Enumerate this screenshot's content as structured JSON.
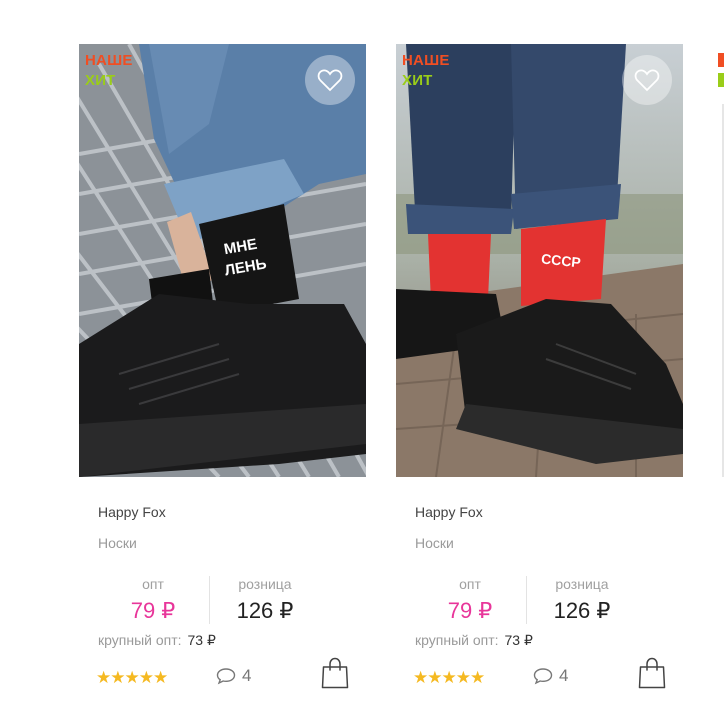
{
  "products": [
    {
      "badge_line1": "НАШЕ",
      "badge_line2": "ХИТ",
      "sock_print_lines": [
        "МНЕ",
        "ЛЕНЬ"
      ],
      "brand": "Happy Fox",
      "category": "Носки",
      "opt_label": "опт",
      "opt_price": "79 ₽",
      "retail_label": "розница",
      "retail_price": "126 ₽",
      "bulk_label": "крупный опт:",
      "bulk_price": "73 ₽",
      "rating": 5,
      "rating_stars": "★★★★★",
      "comments_count": "4",
      "icons": [
        "heart-icon",
        "comment-icon",
        "shopping-bag-icon"
      ]
    },
    {
      "badge_line1": "НАШЕ",
      "badge_line2": "ХИТ",
      "sock_print_lines": [
        "СССР"
      ],
      "brand": "Happy Fox",
      "category": "Носки",
      "opt_label": "опт",
      "opt_price": "79 ₽",
      "retail_label": "розница",
      "retail_price": "126 ₽",
      "bulk_label": "крупный опт:",
      "bulk_price": "73 ₽",
      "rating": 5,
      "rating_stars": "★★★★★",
      "comments_count": "4",
      "icons": [
        "heart-icon",
        "comment-icon",
        "shopping-bag-icon"
      ]
    }
  ],
  "colors": {
    "badge_line1": "#f04e23",
    "badge_line2": "#9acd19",
    "opt_price": "#e8369a",
    "stars": "#f5b921"
  }
}
